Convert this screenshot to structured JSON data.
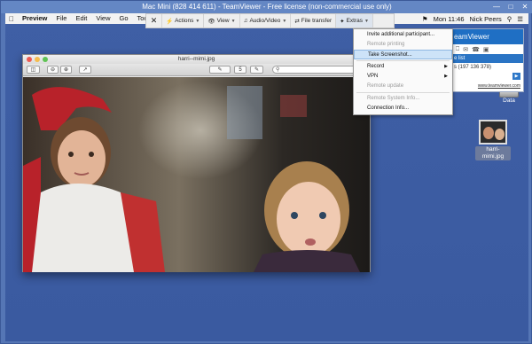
{
  "window": {
    "title": "Mac Mini (828 414 611) - TeamViewer - Free license (non-commercial use only)"
  },
  "menubar": {
    "items": [
      "Preview",
      "File",
      "Edit",
      "View",
      "Go",
      "Tools"
    ],
    "time": "Mon 11:46",
    "user": "Nick Peers"
  },
  "toolbar": {
    "actions": "Actions",
    "view": "View",
    "audio_video": "Audio/Video",
    "file_transfer": "File transfer",
    "extras": "Extras"
  },
  "extras_menu": {
    "items": [
      {
        "label": "Invite additional participant..."
      },
      {
        "label": "Remote printing"
      },
      {
        "label": "Take Screenshot..."
      },
      {
        "label": "Record"
      },
      {
        "label": "VPN"
      },
      {
        "label": "Remote update"
      },
      {
        "label": "Remote System Info..."
      },
      {
        "label": "Connection Info..."
      }
    ]
  },
  "tv_panel": {
    "brand": "eamViewer",
    "list_label": "e list",
    "partner": "s (197 136 378)",
    "link": "www.teamviewer.com"
  },
  "desktop": {
    "data_label": "Data",
    "file_label_1": "harri-",
    "file_label_2": "mimi.jpg"
  },
  "preview": {
    "title": "harri--mimi.jpg",
    "zoom_page": "5"
  },
  "colors": {
    "desktop": "#3f5fa5",
    "tv_blue": "#1f6fc4",
    "menu_highlight": "#cde3f8"
  }
}
